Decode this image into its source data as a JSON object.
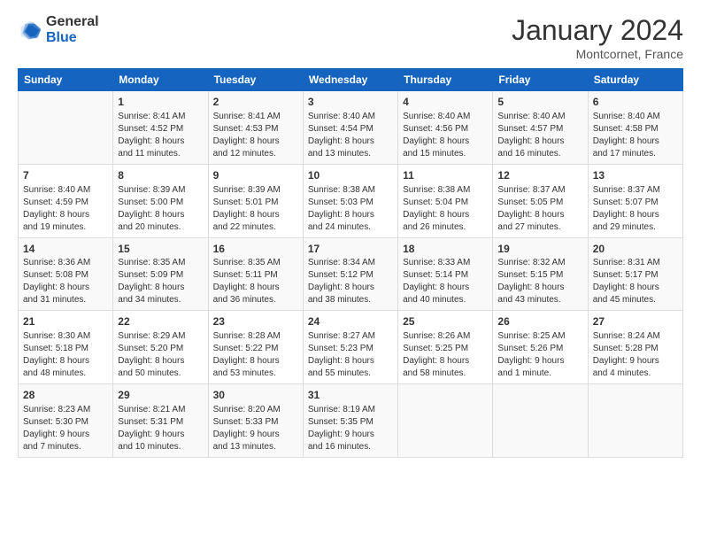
{
  "logo": {
    "general": "General",
    "blue": "Blue"
  },
  "title": "January 2024",
  "location": "Montcornet, France",
  "headers": [
    "Sunday",
    "Monday",
    "Tuesday",
    "Wednesday",
    "Thursday",
    "Friday",
    "Saturday"
  ],
  "weeks": [
    [
      {
        "day": "",
        "info": ""
      },
      {
        "day": "1",
        "info": "Sunrise: 8:41 AM\nSunset: 4:52 PM\nDaylight: 8 hours\nand 11 minutes."
      },
      {
        "day": "2",
        "info": "Sunrise: 8:41 AM\nSunset: 4:53 PM\nDaylight: 8 hours\nand 12 minutes."
      },
      {
        "day": "3",
        "info": "Sunrise: 8:40 AM\nSunset: 4:54 PM\nDaylight: 8 hours\nand 13 minutes."
      },
      {
        "day": "4",
        "info": "Sunrise: 8:40 AM\nSunset: 4:56 PM\nDaylight: 8 hours\nand 15 minutes."
      },
      {
        "day": "5",
        "info": "Sunrise: 8:40 AM\nSunset: 4:57 PM\nDaylight: 8 hours\nand 16 minutes."
      },
      {
        "day": "6",
        "info": "Sunrise: 8:40 AM\nSunset: 4:58 PM\nDaylight: 8 hours\nand 17 minutes."
      }
    ],
    [
      {
        "day": "7",
        "info": "Sunrise: 8:40 AM\nSunset: 4:59 PM\nDaylight: 8 hours\nand 19 minutes."
      },
      {
        "day": "8",
        "info": "Sunrise: 8:39 AM\nSunset: 5:00 PM\nDaylight: 8 hours\nand 20 minutes."
      },
      {
        "day": "9",
        "info": "Sunrise: 8:39 AM\nSunset: 5:01 PM\nDaylight: 8 hours\nand 22 minutes."
      },
      {
        "day": "10",
        "info": "Sunrise: 8:38 AM\nSunset: 5:03 PM\nDaylight: 8 hours\nand 24 minutes."
      },
      {
        "day": "11",
        "info": "Sunrise: 8:38 AM\nSunset: 5:04 PM\nDaylight: 8 hours\nand 26 minutes."
      },
      {
        "day": "12",
        "info": "Sunrise: 8:37 AM\nSunset: 5:05 PM\nDaylight: 8 hours\nand 27 minutes."
      },
      {
        "day": "13",
        "info": "Sunrise: 8:37 AM\nSunset: 5:07 PM\nDaylight: 8 hours\nand 29 minutes."
      }
    ],
    [
      {
        "day": "14",
        "info": "Sunrise: 8:36 AM\nSunset: 5:08 PM\nDaylight: 8 hours\nand 31 minutes."
      },
      {
        "day": "15",
        "info": "Sunrise: 8:35 AM\nSunset: 5:09 PM\nDaylight: 8 hours\nand 34 minutes."
      },
      {
        "day": "16",
        "info": "Sunrise: 8:35 AM\nSunset: 5:11 PM\nDaylight: 8 hours\nand 36 minutes."
      },
      {
        "day": "17",
        "info": "Sunrise: 8:34 AM\nSunset: 5:12 PM\nDaylight: 8 hours\nand 38 minutes."
      },
      {
        "day": "18",
        "info": "Sunrise: 8:33 AM\nSunset: 5:14 PM\nDaylight: 8 hours\nand 40 minutes."
      },
      {
        "day": "19",
        "info": "Sunrise: 8:32 AM\nSunset: 5:15 PM\nDaylight: 8 hours\nand 43 minutes."
      },
      {
        "day": "20",
        "info": "Sunrise: 8:31 AM\nSunset: 5:17 PM\nDaylight: 8 hours\nand 45 minutes."
      }
    ],
    [
      {
        "day": "21",
        "info": "Sunrise: 8:30 AM\nSunset: 5:18 PM\nDaylight: 8 hours\nand 48 minutes."
      },
      {
        "day": "22",
        "info": "Sunrise: 8:29 AM\nSunset: 5:20 PM\nDaylight: 8 hours\nand 50 minutes."
      },
      {
        "day": "23",
        "info": "Sunrise: 8:28 AM\nSunset: 5:22 PM\nDaylight: 8 hours\nand 53 minutes."
      },
      {
        "day": "24",
        "info": "Sunrise: 8:27 AM\nSunset: 5:23 PM\nDaylight: 8 hours\nand 55 minutes."
      },
      {
        "day": "25",
        "info": "Sunrise: 8:26 AM\nSunset: 5:25 PM\nDaylight: 8 hours\nand 58 minutes."
      },
      {
        "day": "26",
        "info": "Sunrise: 8:25 AM\nSunset: 5:26 PM\nDaylight: 9 hours\nand 1 minute."
      },
      {
        "day": "27",
        "info": "Sunrise: 8:24 AM\nSunset: 5:28 PM\nDaylight: 9 hours\nand 4 minutes."
      }
    ],
    [
      {
        "day": "28",
        "info": "Sunrise: 8:23 AM\nSunset: 5:30 PM\nDaylight: 9 hours\nand 7 minutes."
      },
      {
        "day": "29",
        "info": "Sunrise: 8:21 AM\nSunset: 5:31 PM\nDaylight: 9 hours\nand 10 minutes."
      },
      {
        "day": "30",
        "info": "Sunrise: 8:20 AM\nSunset: 5:33 PM\nDaylight: 9 hours\nand 13 minutes."
      },
      {
        "day": "31",
        "info": "Sunrise: 8:19 AM\nSunset: 5:35 PM\nDaylight: 9 hours\nand 16 minutes."
      },
      {
        "day": "",
        "info": ""
      },
      {
        "day": "",
        "info": ""
      },
      {
        "day": "",
        "info": ""
      }
    ]
  ]
}
